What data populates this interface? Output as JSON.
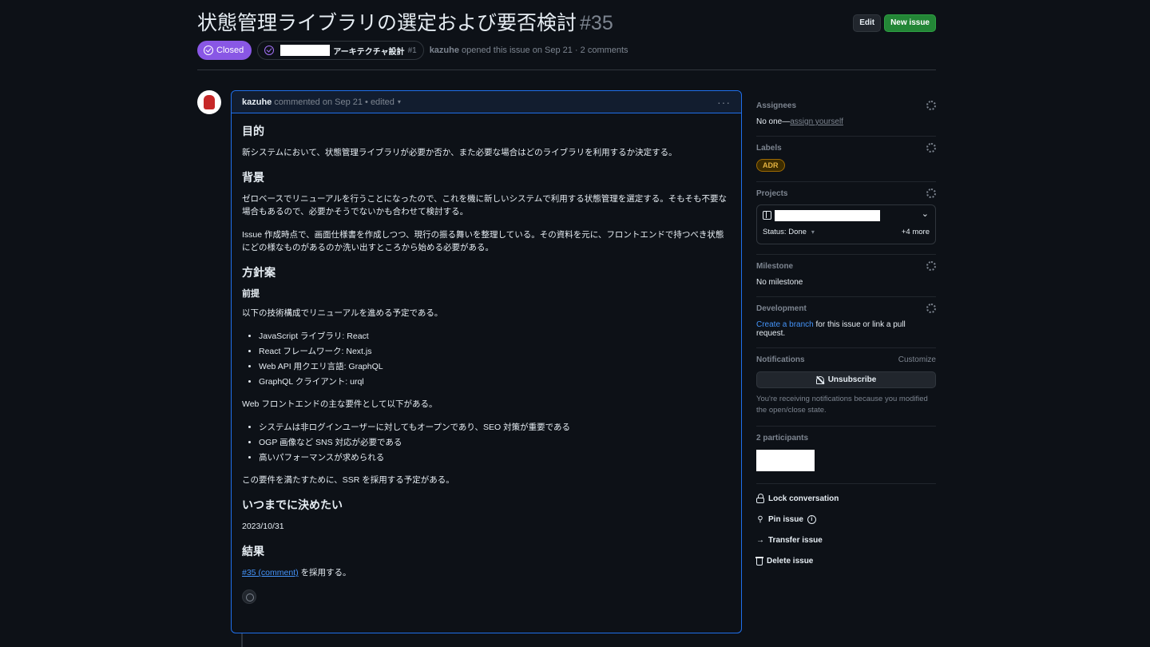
{
  "issue": {
    "title": "状態管理ライブラリの選定および要否検討",
    "number": "#35",
    "state": "Closed",
    "parent": {
      "title": "アーキテクチャ設計",
      "number": "#1"
    },
    "author": "kazuhe",
    "opened_text": "opened this issue on Sep 21 · 2 comments"
  },
  "header_buttons": {
    "edit": "Edit",
    "new_issue": "New issue"
  },
  "comment": {
    "author": "kazuhe",
    "meta": "commented on Sep 21 • edited",
    "caret": "▾",
    "menu": "···",
    "h_purpose": "目的",
    "p_purpose": "新システムにおいて、状態管理ライブラリが必要か否か、また必要な場合はどのライブラリを利用するか決定する。",
    "h_background": "背景",
    "p_background1": "ゼロベースでリニューアルを行うことになったので、これを機に新しいシステムで利用する状態管理を選定する。そもそも不要な場合もあるので、必要かそうでないかも合わせて検討する。",
    "p_background2": "Issue 作成時点で、画面仕様書を作成しつつ、現行の振る舞いを整理している。その資料を元に、フロントエンドで持つべき状態にどの様なものがあるのか洗い出すところから始める必要がある。",
    "h_policy": "方針案",
    "h_premise": "前提",
    "p_premise": "以下の技術構成でリニューアルを進める予定である。",
    "stack": [
      "JavaScript ライブラリ: React",
      "React フレームワーク: Next.js",
      "Web API 用クエリ言語: GraphQL",
      "GraphQL クライアント: urql"
    ],
    "p_requirements": "Web フロントエンドの主な要件として以下がある。",
    "requirements": [
      "システムは非ログインユーザーに対してもオープンであり、SEO 対策が重要である",
      "OGP 画像など SNS 対応が必要である",
      "高いパフォーマンスが求められる"
    ],
    "p_ssr": "この要件を満たすために、SSR を採用する予定がある。",
    "h_deadline": "いつまでに決めたい",
    "p_deadline": "2023/10/31",
    "h_result": "結果",
    "result_link": "#35 (comment)",
    "result_text": " を採用する。"
  },
  "sidebar": {
    "assignees": {
      "label": "Assignees",
      "value_prefix": "No one—",
      "value_link": "assign yourself"
    },
    "labels": {
      "label": "Labels",
      "items": [
        "ADR"
      ]
    },
    "projects": {
      "label": "Projects",
      "status": "Status: Done",
      "status_caret": "▾",
      "more": "+4 more",
      "chevron": "⌄"
    },
    "milestone": {
      "label": "Milestone",
      "value": "No milestone"
    },
    "development": {
      "label": "Development",
      "link": "Create a branch",
      "text": " for this issue or link a pull request."
    },
    "notifications": {
      "label": "Notifications",
      "customize": "Customize",
      "button": "Unsubscribe",
      "note": "You're receiving notifications because you modified the open/close state."
    },
    "participants": {
      "label": "2 participants"
    },
    "actions": {
      "lock": "Lock conversation",
      "pin": "Pin issue",
      "pin_info": "i",
      "transfer": "Transfer issue",
      "transfer_icon": "→",
      "delete": "Delete issue"
    }
  },
  "colors": {
    "background": "#0d1117",
    "closed_badge": "#8957e5",
    "accent_blue": "#4493f8",
    "new_issue_green": "#238636",
    "label_adr": "#e3b341"
  }
}
